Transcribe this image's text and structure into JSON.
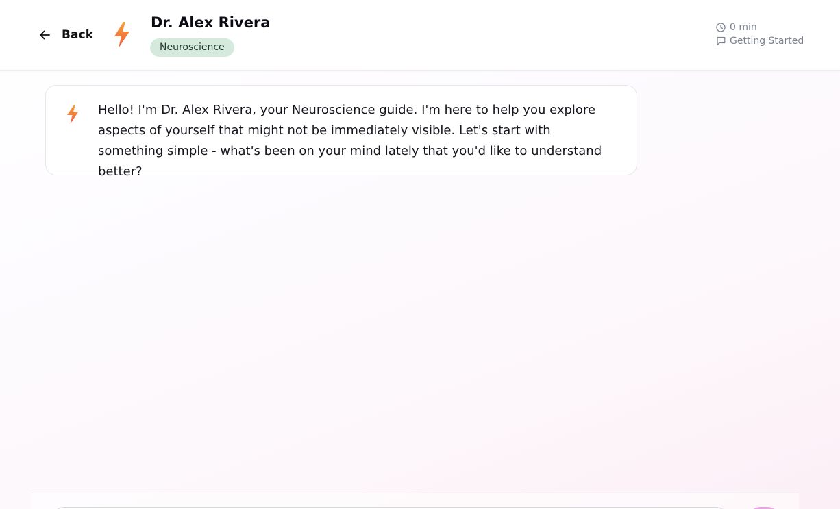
{
  "header": {
    "back_label": "Back",
    "back_icon": "arrow-left-icon",
    "avatar_icon": "lightning-bolt-icon",
    "title": "Dr. Alex Rivera",
    "badge": "Neuroscience",
    "duration": "0 min",
    "duration_icon": "clock-icon",
    "stage": "Getting Started",
    "stage_icon": "chat-bubble-icon"
  },
  "conversation": {
    "messages": [
      {
        "sender": "assistant",
        "icon": "lightning-bolt-icon",
        "text": "Hello! I'm Dr. Alex Rivera, your Neuroscience guide. I'm here to help you explore aspects of yourself that might not be immediately visible. Let's start with something simple - what's been on your mind lately that you'd like to understand better?"
      }
    ]
  },
  "colors": {
    "bolt_top": "#f6a23c",
    "bolt_bottom": "#ef5a3c",
    "badge_bg": "#d5e9dd",
    "badge_text": "#1d3a2a",
    "meta_text": "#7d8390",
    "send_button": "#e9a6e0"
  }
}
